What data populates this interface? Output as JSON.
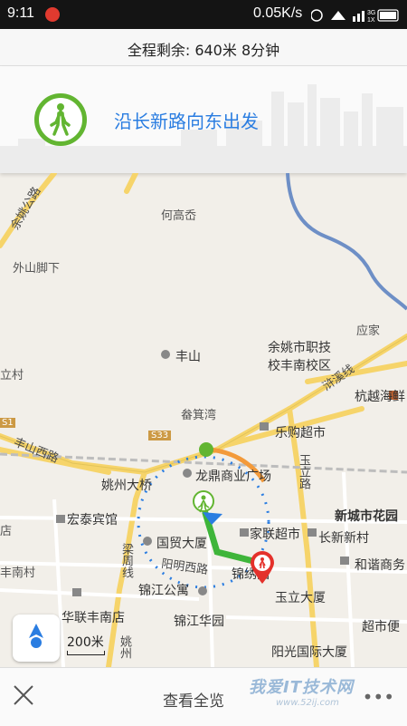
{
  "status_bar": {
    "time": "9:11",
    "speed": "0.05K/s",
    "network_3g": "3G",
    "network_1x": "1X"
  },
  "summary": {
    "text": "全程剩余: 640米 8分钟"
  },
  "guidance": {
    "instruction": "沿长新路向东出发",
    "icon": "pedestrian-icon"
  },
  "map": {
    "labels": {
      "hegaocen": "何高岙",
      "yuyao_road": "余姚公路",
      "waishanjiaoxia": "外山脚下",
      "yingjia": "应家",
      "fengshan": "丰山",
      "school": "余姚市职技",
      "school2": "校丰南校区",
      "yuxi_line": "浒溪线",
      "lichun": "立村",
      "hangyue": "杭越海鲜",
      "yijiwan": "畚箕湾",
      "legou": "乐购超市",
      "s1": "S1",
      "s33": "S33",
      "fengshan_west": "丰山西路",
      "yaozhou_bridge": "姚州大桥",
      "longding": "龙鼎商业广场",
      "yuli_road": "玉立路",
      "xincheng": "新城市花园",
      "hongtai": "宏泰宾馆",
      "guomao": "国贸大厦",
      "jialian": "家联超市",
      "changxin": "长新新村",
      "dian": "店",
      "fengnan": "丰南村",
      "liangzhou": "梁周线",
      "yangming": "阳明西路",
      "jinbao": "锦绣园",
      "hexie": "和谐商务",
      "jinjiang_apt": "锦江公寓",
      "yuli_bldg": "玉立大厦",
      "hualian": "华联丰南店",
      "jinjiang_garden": "锦江华园",
      "chaoshi": "超市便",
      "yaozhou": "姚州",
      "yangguang": "阳光国际大厦"
    },
    "colors": {
      "route": "#3fb53a",
      "start": "#62b531",
      "end": "#e4312b",
      "accent": "#2a7de1",
      "arc": "#f39a3a",
      "major_road": "#f6d46a"
    },
    "scale": "200米"
  },
  "bottom_bar": {
    "overview": "查看全览",
    "more": "•••"
  },
  "watermark": {
    "text": "我爱IT技术网",
    "url": "www.52ij.com"
  }
}
